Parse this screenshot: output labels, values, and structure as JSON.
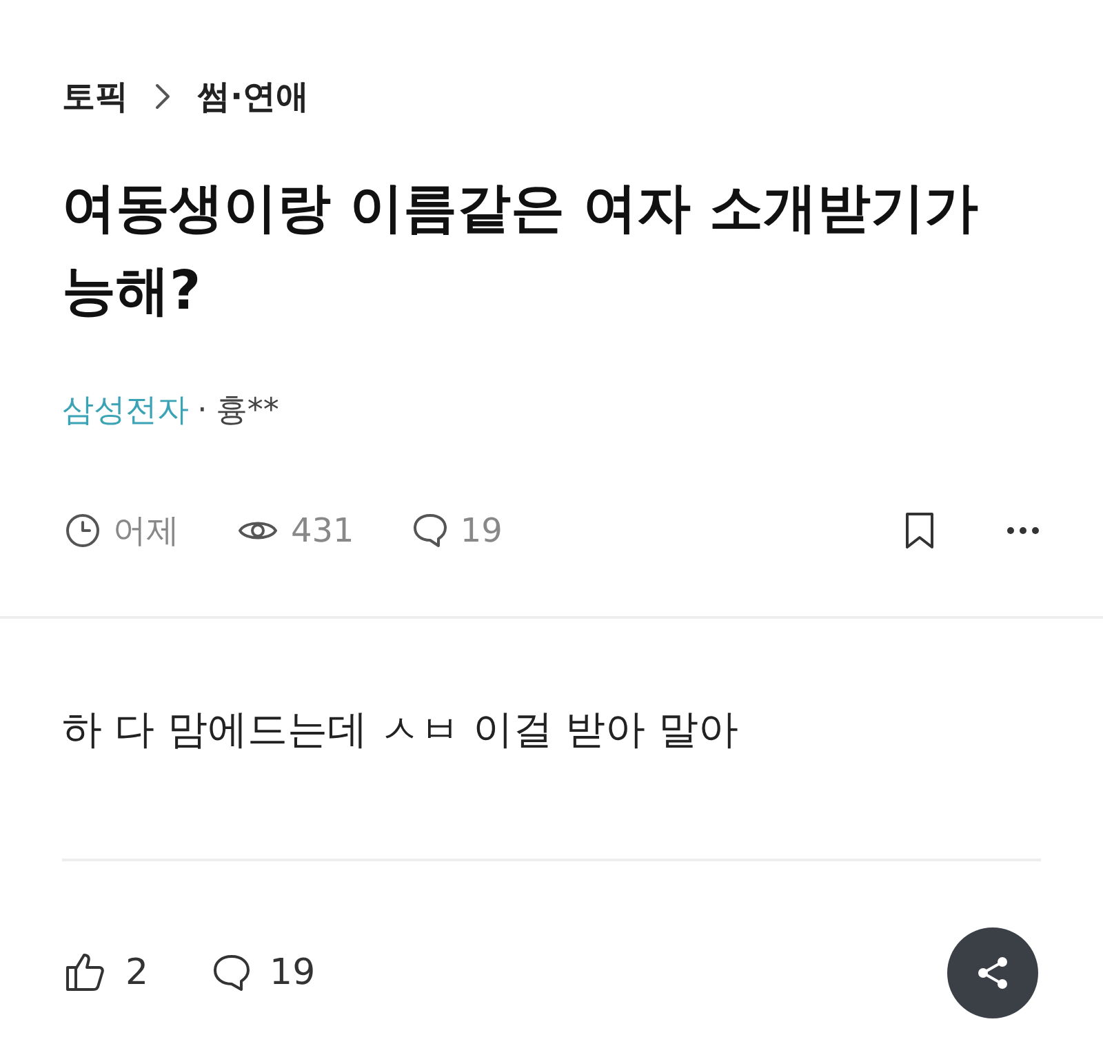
{
  "breadcrumb": [
    {
      "label": "토픽"
    },
    {
      "label": "썸·연애"
    }
  ],
  "title": "여동생이랑 이름같은 여자 소개받기가 능해?",
  "author": {
    "company": "삼성전자",
    "separator": "·",
    "name": "흉**"
  },
  "stats": {
    "time": "어제",
    "views": "431",
    "comments": "19"
  },
  "body": "하 다 맘에드는데 ㅅㅂ 이걸 받아 말아",
  "footer": {
    "likes": "2",
    "comments": "19"
  }
}
